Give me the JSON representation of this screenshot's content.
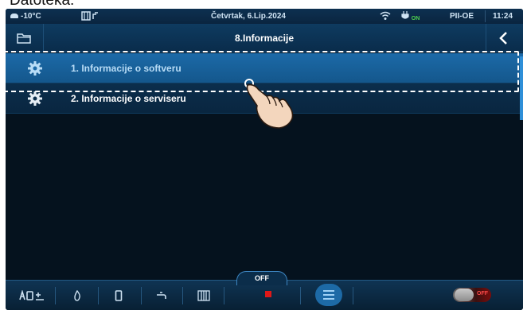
{
  "caption": "Datoteka:",
  "status_bar": {
    "temperature": "-10°C",
    "date": "Četvrtak, 6.Lip.2024",
    "phase_on_label": "ON",
    "mode": "PII-OE",
    "time": "11:24"
  },
  "header": {
    "title": "8.Informacije",
    "folder_icon": "folder-icon",
    "back_icon": "chevron-left-icon"
  },
  "list": {
    "items": [
      {
        "label": "1. Informacije o softveru",
        "icon": "gear-icon",
        "selected": true
      },
      {
        "label": "2. Informacije o serviseru",
        "icon": "gear-icon",
        "selected": false
      }
    ]
  },
  "bottom_bar": {
    "off_label": "OFF",
    "toggle_label": "OFF",
    "buttons": [
      "boiler-mode-icon",
      "flame-icon",
      "tank-icon",
      "tap-icon",
      "radiator-icon",
      "stop-icon",
      "menu-icon"
    ]
  },
  "colors": {
    "selected_row": "#1c6aa8",
    "background": "#05121e",
    "stop_red": "#e01818"
  }
}
